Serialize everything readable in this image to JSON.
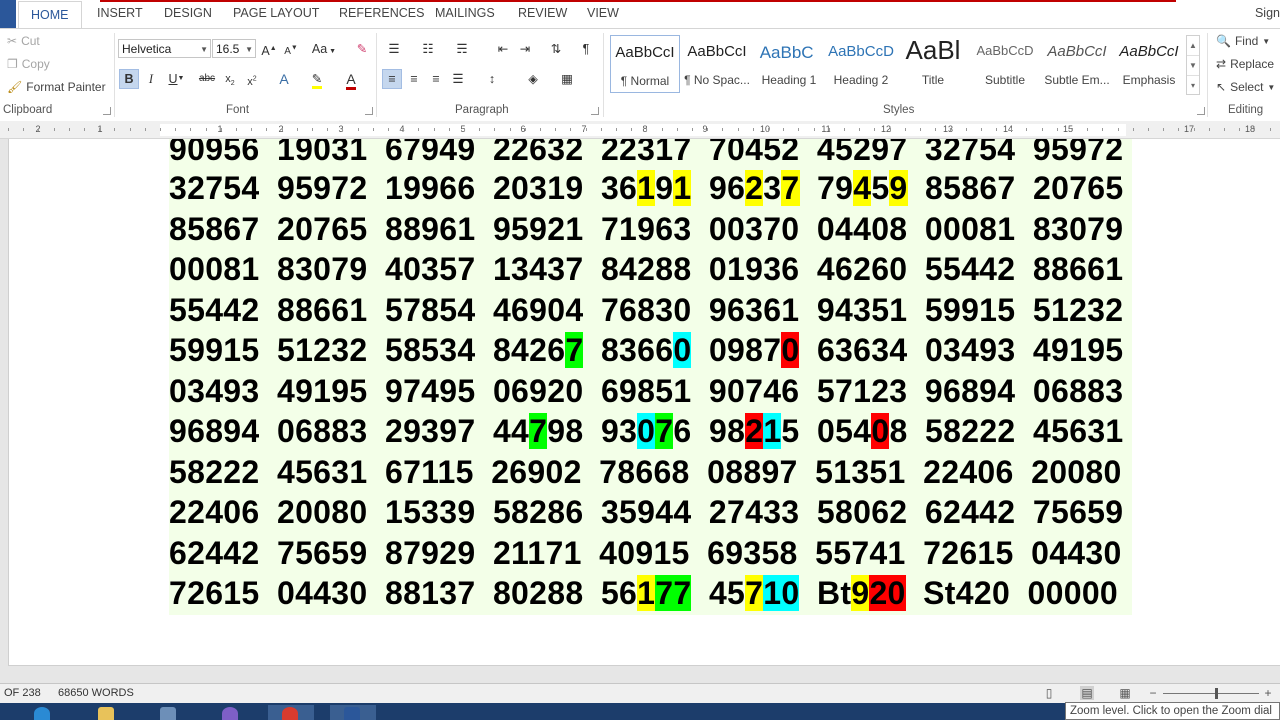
{
  "tabs": [
    {
      "label": "HOME",
      "active": true
    },
    {
      "label": "INSERT"
    },
    {
      "label": "DESIGN"
    },
    {
      "label": "PAGE LAYOUT"
    },
    {
      "label": "REFERENCES"
    },
    {
      "label": "MAILINGS"
    },
    {
      "label": "REVIEW"
    },
    {
      "label": "VIEW"
    }
  ],
  "sign_in": "Sign",
  "clipboard": {
    "cut": "Cut",
    "copy": "Copy",
    "format_painter": "Format Painter",
    "group": "Clipboard"
  },
  "font": {
    "family": "Helvetica",
    "size": "16.5",
    "group": "Font",
    "change_case": "Aa"
  },
  "paragraph": {
    "group": "Paragraph"
  },
  "styles": {
    "group": "Styles",
    "items": [
      {
        "preview": "AaBbCcI",
        "name": "¶ Normal",
        "selected": true,
        "color": "#222222"
      },
      {
        "preview": "AaBbCcI",
        "name": "¶ No Spac...",
        "color": "#222222"
      },
      {
        "preview": "AaBbC ",
        "name": "Heading 1",
        "color": "#2e74b5"
      },
      {
        "preview": "AaBbCcD",
        "name": "Heading 2",
        "color": "#2e74b5"
      },
      {
        "preview": "AaBl",
        "name": "Title",
        "color": "#111111"
      },
      {
        "preview": "AaBbCcD",
        "name": "Subtitle",
        "color": "#666666"
      },
      {
        "preview": "AaBbCcI",
        "name": "Subtle Em...",
        "color": "#555555"
      },
      {
        "preview": "AaBbCcI",
        "name": "Emphasis",
        "color": "#222222"
      }
    ]
  },
  "editing": {
    "find": "Find",
    "replace": "Replace",
    "select": "Select",
    "group": "Editing"
  },
  "ruler": {
    "numbers": [
      "2",
      "1",
      "1",
      "2",
      "3",
      "4",
      "5",
      "6",
      "7",
      "8",
      "9",
      "10",
      "11",
      "12",
      "13",
      "14",
      "15",
      "17",
      "18"
    ]
  },
  "highlight_colors": {
    "y": "#ffff00",
    "g": "#00ff00",
    "c": "#00ffff",
    "r": "#ff0000"
  },
  "document": {
    "rows": [
      [
        "90956",
        "19031",
        "67949",
        "22632",
        "22317",
        "70452",
        "45297",
        "32754",
        "95972"
      ],
      [
        "32754",
        "95972",
        "19966",
        "20319",
        "36[y1]9[y1]",
        "96[y2]3[y7]",
        "79[y4]5[y9]",
        "85867",
        "20765"
      ],
      [
        "85867",
        "20765",
        "88961",
        "95921",
        "71963",
        "00370",
        "04408",
        "00081",
        "83079"
      ],
      [
        "00081",
        "83079",
        "40357",
        "13437",
        "84288",
        "01936",
        "46260",
        "55442",
        "88661"
      ],
      [
        "55442",
        "88661",
        "57854",
        "46904",
        "76830",
        "96361",
        "94351",
        "59915",
        "51232"
      ],
      [
        "59915",
        "51232",
        "58534",
        "8426[g7]",
        "8366[c0]",
        "0987[r0]",
        "63634",
        "03493",
        "49195"
      ],
      [
        "03493",
        "49195",
        "97495",
        "06920",
        "69851",
        "90746",
        "57123",
        "96894",
        "06883"
      ],
      [
        "96894",
        "06883",
        "29397",
        "44[g7]98",
        "93[c0][g7]6",
        "98[r2][c1]5",
        "054[r0]8",
        "58222",
        "45631"
      ],
      [
        "58222",
        "45631",
        "67115",
        "26902",
        "78668",
        "08897",
        "51351",
        "22406",
        "20080"
      ],
      [
        "22406",
        "20080",
        "15339",
        "58286",
        "35944",
        "27433",
        "58062",
        "62442",
        "75659"
      ],
      [
        "62442",
        "75659",
        "87929",
        "21171",
        "40915",
        "69358",
        "55741",
        "72615",
        "04430"
      ],
      [
        "72615",
        "04430",
        "88137",
        "80288",
        "56[y1][g77]",
        "45[y7][c10]",
        "Bt[y9][r20]",
        "St420",
        "00000"
      ]
    ]
  },
  "status": {
    "page": "OF 238",
    "words": "68650 WORDS"
  },
  "tooltip": "Zoom level. Click to open the Zoom dial"
}
